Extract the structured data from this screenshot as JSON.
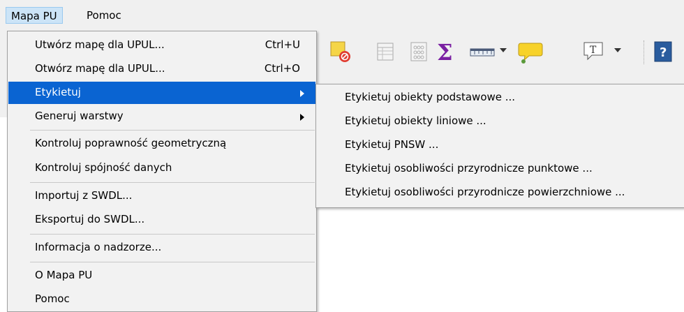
{
  "menubar": {
    "items": [
      {
        "label": "Mapa PU"
      },
      {
        "label": "Pomoc"
      }
    ]
  },
  "toolbar": {
    "icons": [
      "layer-remove-icon",
      "attribute-table-icon",
      "field-calculator-icon",
      "statistics-sum-icon",
      "measure-ruler-icon",
      "map-tips-icon",
      "text-annotation-icon",
      "help-icon"
    ],
    "colors": {
      "sum": "#7a1fa2",
      "tips": "#f7d22a",
      "help": "#2a5c9e",
      "remove": "#e03c31",
      "square": "#f5d547"
    }
  },
  "menu": {
    "items": [
      {
        "label": "Utwórz mapę dla UPUL...",
        "shortcut": "Ctrl+U"
      },
      {
        "label": "Otwórz mapę dla UPUL...",
        "shortcut": "Ctrl+O"
      },
      {
        "label": "Etykietuj"
      },
      {
        "label": "Generuj warstwy"
      },
      {
        "label": "Kontroluj poprawność geometryczną"
      },
      {
        "label": "Kontroluj spójność danych"
      },
      {
        "label": "Importuj z SWDL..."
      },
      {
        "label": "Eksportuj do SWDL..."
      },
      {
        "label": "Informacja o nadzorze..."
      },
      {
        "label": "O Mapa PU"
      },
      {
        "label": "Pomoc"
      }
    ],
    "highlight_color": "#0a64d2"
  },
  "submenu": {
    "items": [
      {
        "label": "Etykietuj obiekty podstawowe ..."
      },
      {
        "label": "Etykietuj obiekty liniowe ..."
      },
      {
        "label": "Etykietuj PNSW ..."
      },
      {
        "label": "Etykietuj osobliwości przyrodnicze punktowe ..."
      },
      {
        "label": "Etykietuj osobliwości przyrodnicze powierzchniowe ..."
      }
    ]
  }
}
